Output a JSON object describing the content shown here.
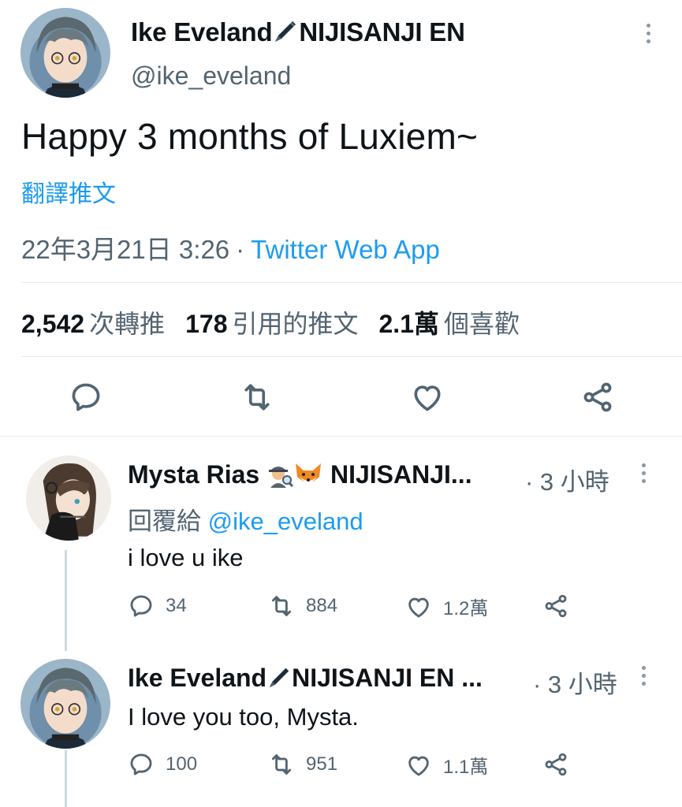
{
  "main_tweet": {
    "display_name": "Ike Eveland",
    "name_suffix": "NIJISANJI EN",
    "handle": "@ike_eveland",
    "text": "Happy 3 months of Luxiem~",
    "translate_label": "翻譯推文",
    "timestamp": "22年3月21日 3:26",
    "separator": "·",
    "source_app": "Twitter Web App",
    "stats": {
      "retweets_count": "2,542",
      "retweets_label": "次轉推",
      "quotes_count": "178",
      "quotes_label": "引用的推文",
      "likes_count": "2.1萬",
      "likes_label": "個喜歡"
    },
    "actions": [
      "reply-icon",
      "retweet-icon",
      "like-icon",
      "share-icon"
    ]
  },
  "replies": [
    {
      "display_name": "Mysta Rias",
      "name_suffix": "NIJISANJI...",
      "time": "· 3 小時",
      "replying_prefix": "回覆給",
      "replying_to": "@ike_eveland",
      "text": "i love u ike",
      "reply_count": "34",
      "retweet_count": "884",
      "like_count": "1.2萬"
    },
    {
      "display_name": "Ike Eveland",
      "name_suffix": "NIJISANJI EN ...",
      "time": "· 3 小時",
      "text": "I love you too, Mysta.",
      "reply_count": "100",
      "retweet_count": "951",
      "like_count": "1.1萬"
    }
  ],
  "colors": {
    "accent": "#1d9bf0",
    "secondary_text": "#536471",
    "primary_text": "#0f1419",
    "divider": "#e6ecf0"
  }
}
